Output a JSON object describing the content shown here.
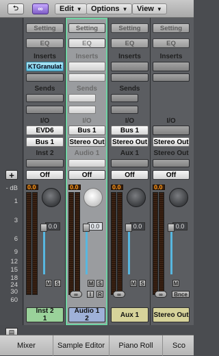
{
  "toolbar": {
    "menus": [
      {
        "label": "Edit"
      },
      {
        "label": "Options"
      },
      {
        "label": "View"
      }
    ]
  },
  "left": {
    "scale": [
      "- dB",
      "1",
      "3",
      "6",
      "9",
      "12",
      "15",
      "18",
      "24",
      "30",
      "60"
    ]
  },
  "strips": [
    {
      "setting": "Setting",
      "eq": "EQ",
      "inserts_label": "Inserts",
      "insert1": "KTGranulat",
      "sends_label": "Sends",
      "io_label": "I/O",
      "input": "EVD6",
      "output": "Bus 1",
      "track_label": "Inst 2",
      "automation": "Off",
      "peak": "0.0",
      "volume": "0.0",
      "mute": "M",
      "solo": "S",
      "name_line1": "Inst 2",
      "name_line2": "1",
      "name_color": "#9ad29a"
    },
    {
      "setting": "Setting",
      "eq": "EQ",
      "inserts_label": "Inserts",
      "sends_label": "Sends",
      "io_label": "I/O",
      "input": "Bus 1",
      "output": "Stereo Out",
      "track_label": "Audio 1",
      "automation": "Off",
      "peak": "0.0",
      "volume": "0.0",
      "mute": "M",
      "solo": "S",
      "link": "∞",
      "input_mon": "I",
      "record": "R",
      "name_line1": "Audio 1",
      "name_line2": "2",
      "name_color": "#9fb1d8"
    },
    {
      "setting": "Setting",
      "eq": "EQ",
      "inserts_label": "Inserts",
      "sends_label": "Sends",
      "io_label": "I/O",
      "input": "Bus 1",
      "output": "Stereo Out",
      "track_label": "Aux 1",
      "automation": "Off",
      "peak": "0.0",
      "volume": "0.0",
      "mute": "M",
      "solo": "S",
      "link": "∞",
      "name_line1": "Aux 1",
      "name_line2": "",
      "name_color": "#d6d39a"
    },
    {
      "setting": "Setting",
      "eq": "EQ",
      "inserts_label": "Inserts",
      "io_label": "I/O",
      "output": "Stereo Out",
      "track_label": "Stereo Out",
      "automation": "Off",
      "peak": "0.0",
      "volume": "0.0",
      "mute": "M",
      "link": "∞",
      "bounce": "Bnce",
      "name_line1": "Stereo Out",
      "name_line2": "",
      "name_color": "#d6d39a"
    }
  ],
  "bottom_tabs": [
    "Mixer",
    "Sample Editor",
    "Piano Roll",
    "Sco"
  ],
  "accent_selected": "#6fd3a3"
}
